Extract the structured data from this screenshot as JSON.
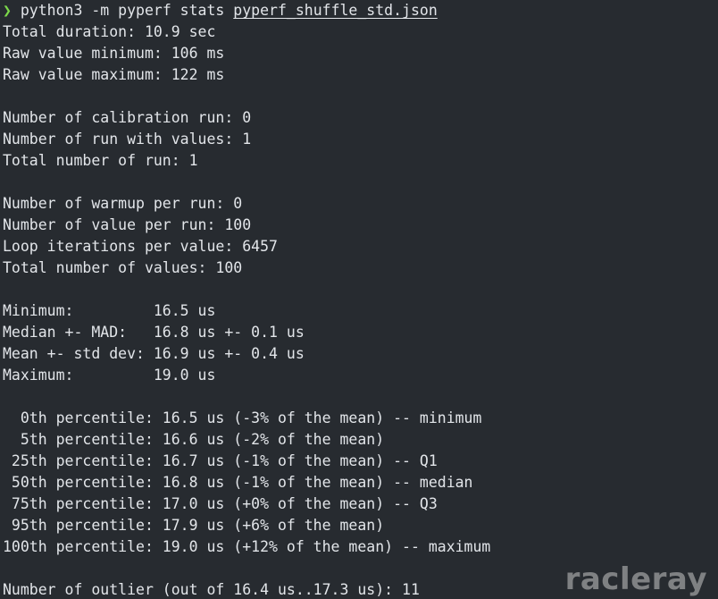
{
  "prompt": {
    "symbol": "❯",
    "command": "python3 -m pyperf stats ",
    "file": "pyperf_shuffle_std.json"
  },
  "output_lines": [
    "Total duration: 10.9 sec",
    "Raw value minimum: 106 ms",
    "Raw value maximum: 122 ms",
    "",
    "Number of calibration run: 0",
    "Number of run with values: 1",
    "Total number of run: 1",
    "",
    "Number of warmup per run: 0",
    "Number of value per run: 100",
    "Loop iterations per value: 6457",
    "Total number of values: 100",
    "",
    "Minimum:         16.5 us",
    "Median +- MAD:   16.8 us +- 0.1 us",
    "Mean +- std dev: 16.9 us +- 0.4 us",
    "Maximum:         19.0 us",
    "",
    "  0th percentile: 16.5 us (-3% of the mean) -- minimum",
    "  5th percentile: 16.6 us (-2% of the mean)",
    " 25th percentile: 16.7 us (-1% of the mean) -- Q1",
    " 50th percentile: 16.8 us (-1% of the mean) -- median",
    " 75th percentile: 17.0 us (+0% of the mean) -- Q3",
    " 95th percentile: 17.9 us (+6% of the mean)",
    "100th percentile: 19.0 us (+12% of the mean) -- maximum",
    "",
    "Number of outlier (out of 16.4 us..17.3 us): 11"
  ],
  "watermark": "racleray",
  "colors": {
    "background": "#272b30",
    "text": "#e2e5e9",
    "prompt_arrow": "#7cd94a"
  }
}
